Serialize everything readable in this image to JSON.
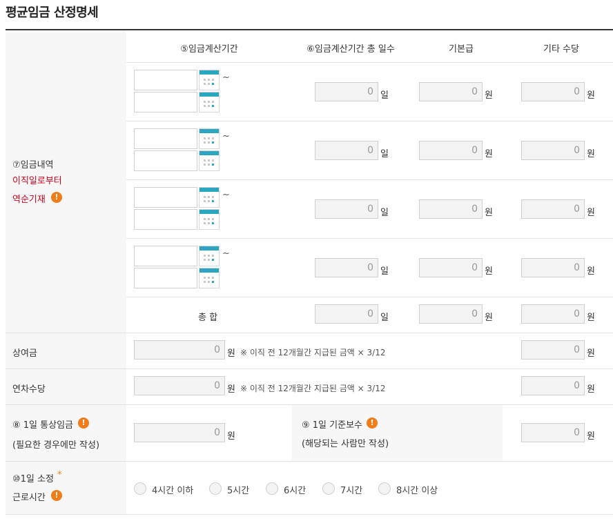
{
  "title": "평균임금 산정명세",
  "headers": {
    "period": "⑤임금계산기간",
    "days": "⑥임금계산기간 총 일수",
    "base": "기본급",
    "other": "기타 수당"
  },
  "wage_section": {
    "label_line1": "⑦임금내역",
    "label_line2": "이직일로부터",
    "label_line3": "역순기재"
  },
  "rows": [
    {
      "days": "0",
      "base": "0",
      "other": "0"
    },
    {
      "days": "0",
      "base": "0",
      "other": "0"
    },
    {
      "days": "0",
      "base": "0",
      "other": "0"
    },
    {
      "days": "0",
      "base": "0",
      "other": "0"
    }
  ],
  "total": {
    "label": "총 합",
    "days": "0",
    "base": "0",
    "other": "0"
  },
  "units": {
    "day": "일",
    "won": "원",
    "tilde": "~"
  },
  "bonus": {
    "label": "상여금",
    "value": "0",
    "note": "※ 이직 전 12개월간 지급된 금액 × 3/12",
    "other": "0"
  },
  "annual": {
    "label": "연차수당",
    "value": "0",
    "note": "※ 이직 전 12개월간 지급된 금액 × 3/12",
    "other": "0"
  },
  "ordinary": {
    "label": "⑧ 1일 통상임금",
    "sub": "(필요한 경우에만 작성)",
    "value": "0"
  },
  "daily_basis": {
    "label": "⑨ 1일 기준보수",
    "sub": "(해당되는 사람만 작성)",
    "value": "0"
  },
  "hours": {
    "label_line1": "⑩1일 소정",
    "label_line2": "근로시간",
    "required_mark": "*",
    "options": [
      "4시간 이하",
      "5시간",
      "6시간",
      "7시간",
      "8시간 이상"
    ]
  },
  "colors": {
    "accent": "#2aa6c0",
    "warning": "#f07c1a",
    "red": "#d0021b"
  },
  "icons": {
    "warning": "!"
  }
}
